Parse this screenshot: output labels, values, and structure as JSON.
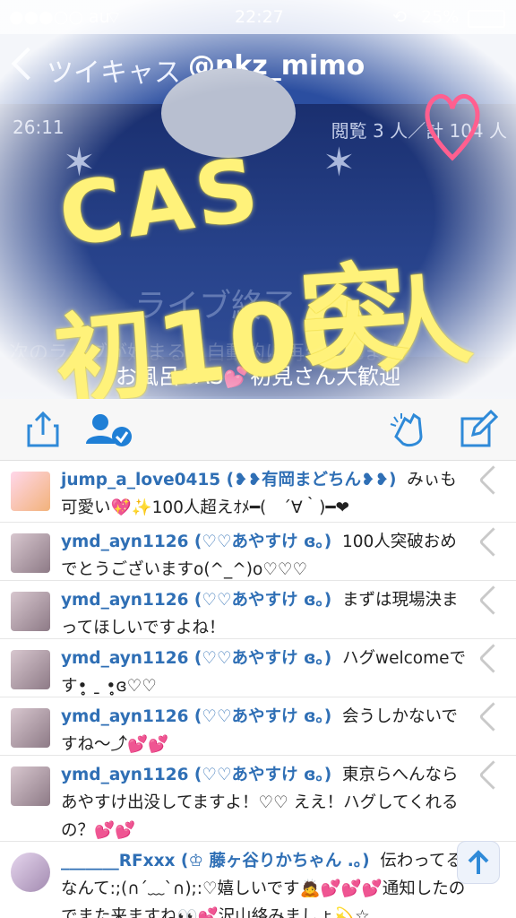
{
  "status_bar": {
    "carrier": "●●●○○ au",
    "time": "22:27",
    "battery": "25%"
  },
  "nav": {
    "back_label": "ツイキャス",
    "title": "@nkz_mimo"
  },
  "video": {
    "timer": "26:11",
    "views": "閲覧 3 人／計 104 人",
    "ended_text": "ライブ終了",
    "ended_sub": "次のライブが始まると自動的に再生されます",
    "caption_prefix": "お風呂CAS",
    "caption_suffix": "初見さん大歓迎"
  },
  "overlay": {
    "line1": "CAS",
    "line2": "初100人",
    "line3": "突破"
  },
  "colors": {
    "accent": "#2f6fb5",
    "nav": "#2b4ea0",
    "overlay_text": "#fff27a",
    "heart": "#ff66b3"
  },
  "comments": [
    {
      "user": "jump_a_love0415 (❥❥有岡まどちん❥❥)",
      "text": "みぃも可愛い💖✨100人超えｵﾒ━(　´∀｀)━❤"
    },
    {
      "user": "ymd_ayn1126 (♡♡あやすけ ɞ｡)",
      "text": "100人突破おめでとうございますo(^_^)o♡♡♡"
    },
    {
      "user": "ymd_ayn1126 (♡♡あやすけ ɞ｡)",
      "text": "まずは現場決まってほしいですよね！"
    },
    {
      "user": "ymd_ayn1126 (♡♡あやすけ ɞ｡)",
      "text": "ハグwelcomeです•̥̥̥ ˍ̱ •̥̥̥ɞ♡♡"
    },
    {
      "user": "ymd_ayn1126 (♡♡あやすけ ɞ｡)",
      "text": "会うしかないですね〜⤴💕💕"
    },
    {
      "user": "ymd_ayn1126 (♡♡あやすけ ɞ｡)",
      "text": "東京らへんならあやすけ出没してますよ！♡♡ ええ！ハグしてくれるの？💕💕"
    },
    {
      "user": "_______RFxxx (♔ 藤ヶ谷りかちゃん .｡)",
      "text": "伝わってるなんて:;(∩´﹏`∩);:♡嬉しいです🙇💕💕💕通知したのでまた来ますね👀💕沢山絡みましょ💫☆"
    }
  ]
}
